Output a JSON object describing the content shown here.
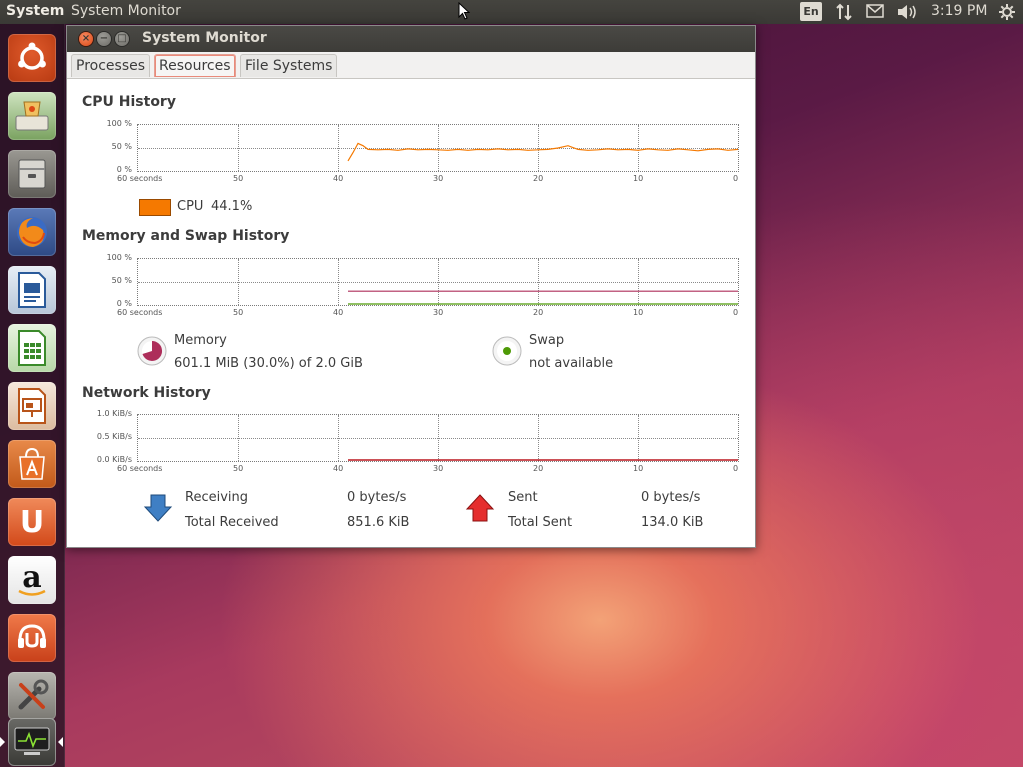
{
  "topbar": {
    "system_label": "System",
    "app_title": "System Monitor",
    "keyboard_layout": "En",
    "time": "3:19 PM"
  },
  "launcher": {
    "items": [
      {
        "name": "ubuntu-dash-icon"
      },
      {
        "name": "system-installer-icon"
      },
      {
        "name": "files-icon"
      },
      {
        "name": "firefox-icon"
      },
      {
        "name": "libreoffice-writer-icon"
      },
      {
        "name": "libreoffice-calc-icon"
      },
      {
        "name": "libreoffice-impress-icon"
      },
      {
        "name": "ubuntu-software-center-icon"
      },
      {
        "name": "ubuntu-one-icon"
      },
      {
        "name": "amazon-icon"
      },
      {
        "name": "ubuntu-one-music-icon"
      },
      {
        "name": "system-settings-icon"
      },
      {
        "name": "system-monitor-icon"
      }
    ],
    "amazon_letter": "a",
    "ubuntu_one_letter": "U"
  },
  "window": {
    "title": "System Monitor",
    "tabs": [
      {
        "label": "Processes",
        "active": false
      },
      {
        "label": "Resources",
        "active": true
      },
      {
        "label": "File Systems",
        "active": false
      }
    ]
  },
  "cpu": {
    "title": "CPU History",
    "y_ticks": [
      "100 %",
      "50 %",
      "0 %"
    ],
    "x_ticks": [
      "60 seconds",
      "50",
      "40",
      "30",
      "20",
      "10",
      "0"
    ],
    "legend_label": "CPU",
    "value": "44.1%",
    "color": "#f57900"
  },
  "memory": {
    "title": "Memory and Swap History",
    "y_ticks": [
      "100 %",
      "50 %",
      "0 %"
    ],
    "x_ticks": [
      "60 seconds",
      "50",
      "40",
      "30",
      "20",
      "10",
      "0"
    ],
    "memory_label": "Memory",
    "memory_value": "601.1 MiB (30.0%) of 2.0 GiB",
    "memory_color": "#ad2e5a",
    "swap_label": "Swap",
    "swap_value": "not available",
    "swap_color": "#4e9a06"
  },
  "network": {
    "title": "Network History",
    "y_ticks": [
      "1.0 KiB/s",
      "0.5 KiB/s",
      "0.0 KiB/s"
    ],
    "x_ticks": [
      "60 seconds",
      "50",
      "40",
      "30",
      "20",
      "10",
      "0"
    ],
    "receiving_label": "Receiving",
    "receiving_value": "0 bytes/s",
    "total_received_label": "Total Received",
    "total_received_value": "851.6 KiB",
    "sent_label": "Sent",
    "sent_value": "0 bytes/s",
    "total_sent_label": "Total Sent",
    "total_sent_value": "134.0 KiB",
    "receiving_color": "#3465a4",
    "sent_color": "#cc0000"
  },
  "chart_data": [
    {
      "type": "line",
      "title": "CPU History",
      "x": [
        39,
        38.5,
        38,
        37.5,
        37,
        36,
        35,
        34,
        33,
        32,
        31,
        30,
        29,
        28,
        27,
        26,
        25,
        24,
        23,
        22,
        21,
        20,
        19,
        18,
        17,
        16,
        15,
        14,
        13,
        12,
        11,
        10,
        9,
        8,
        7,
        6,
        5,
        4,
        3,
        2,
        1,
        0
      ],
      "series": [
        {
          "name": "CPU",
          "values": [
            22,
            40,
            60,
            55,
            47,
            46,
            47,
            45,
            48,
            46,
            47,
            46,
            45,
            47,
            45,
            47,
            46,
            48,
            46,
            47,
            45,
            46,
            47,
            50,
            55,
            47,
            45,
            46,
            48,
            46,
            47,
            45,
            48,
            46,
            45,
            48,
            46,
            44,
            47,
            48,
            45,
            47
          ]
        }
      ],
      "xlim": [
        60,
        0
      ],
      "ylim": [
        0,
        100
      ]
    },
    {
      "type": "line",
      "title": "Memory and Swap History",
      "x": [
        39,
        0
      ],
      "series": [
        {
          "name": "Memory",
          "values": [
            30,
            30
          ]
        },
        {
          "name": "Swap",
          "values": [
            0,
            0
          ]
        }
      ],
      "xlim": [
        60,
        0
      ],
      "ylim": [
        0,
        100
      ]
    },
    {
      "type": "line",
      "title": "Network History",
      "x": [
        39,
        0
      ],
      "series": [
        {
          "name": "Receiving",
          "values": [
            0,
            0
          ]
        },
        {
          "name": "Sent",
          "values": [
            0,
            0
          ]
        }
      ],
      "xlim": [
        60,
        0
      ],
      "ylim": [
        0,
        1.0
      ]
    }
  ]
}
